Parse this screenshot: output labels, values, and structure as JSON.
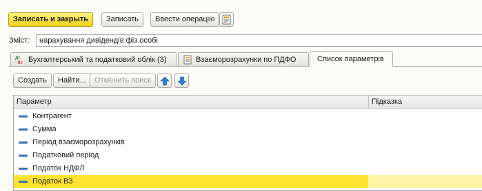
{
  "toolbar": {
    "save_close_label": "Записать и закрыть",
    "save_label": "Записать",
    "enter_operation_label": "Ввести операцію"
  },
  "content_field": {
    "label": "Зміст:",
    "value": "нарахування дивідендів фіз.особі"
  },
  "tabs": [
    {
      "label": "Бухгалтерський та податковий облік (3)",
      "icon": "dt-kt-icon"
    },
    {
      "label": "Взаєморозрахунки по ПДФО",
      "icon": "document-icon"
    },
    {
      "label": "Список параметрів",
      "active": true
    }
  ],
  "table_toolbar": {
    "create_label": "Создать",
    "find_label": "Найти...",
    "cancel_search_label": "Отменить поиск"
  },
  "table": {
    "columns": [
      "Параметр",
      "Підказка"
    ],
    "rows": [
      {
        "param": "Контрагент",
        "hint": ""
      },
      {
        "param": "Сумма",
        "hint": ""
      },
      {
        "param": "Період взаєморозрахунків",
        "hint": ""
      },
      {
        "param": "Податковий період",
        "hint": ""
      },
      {
        "param": "Податок НДФЛ",
        "hint": ""
      },
      {
        "param": "Податок ВЗ",
        "hint": "",
        "selected": true
      }
    ]
  },
  "colors": {
    "primary_button": "#f2d21a",
    "selected_row": "#ffe32e",
    "arrow_icons": "#2f7fd6"
  }
}
